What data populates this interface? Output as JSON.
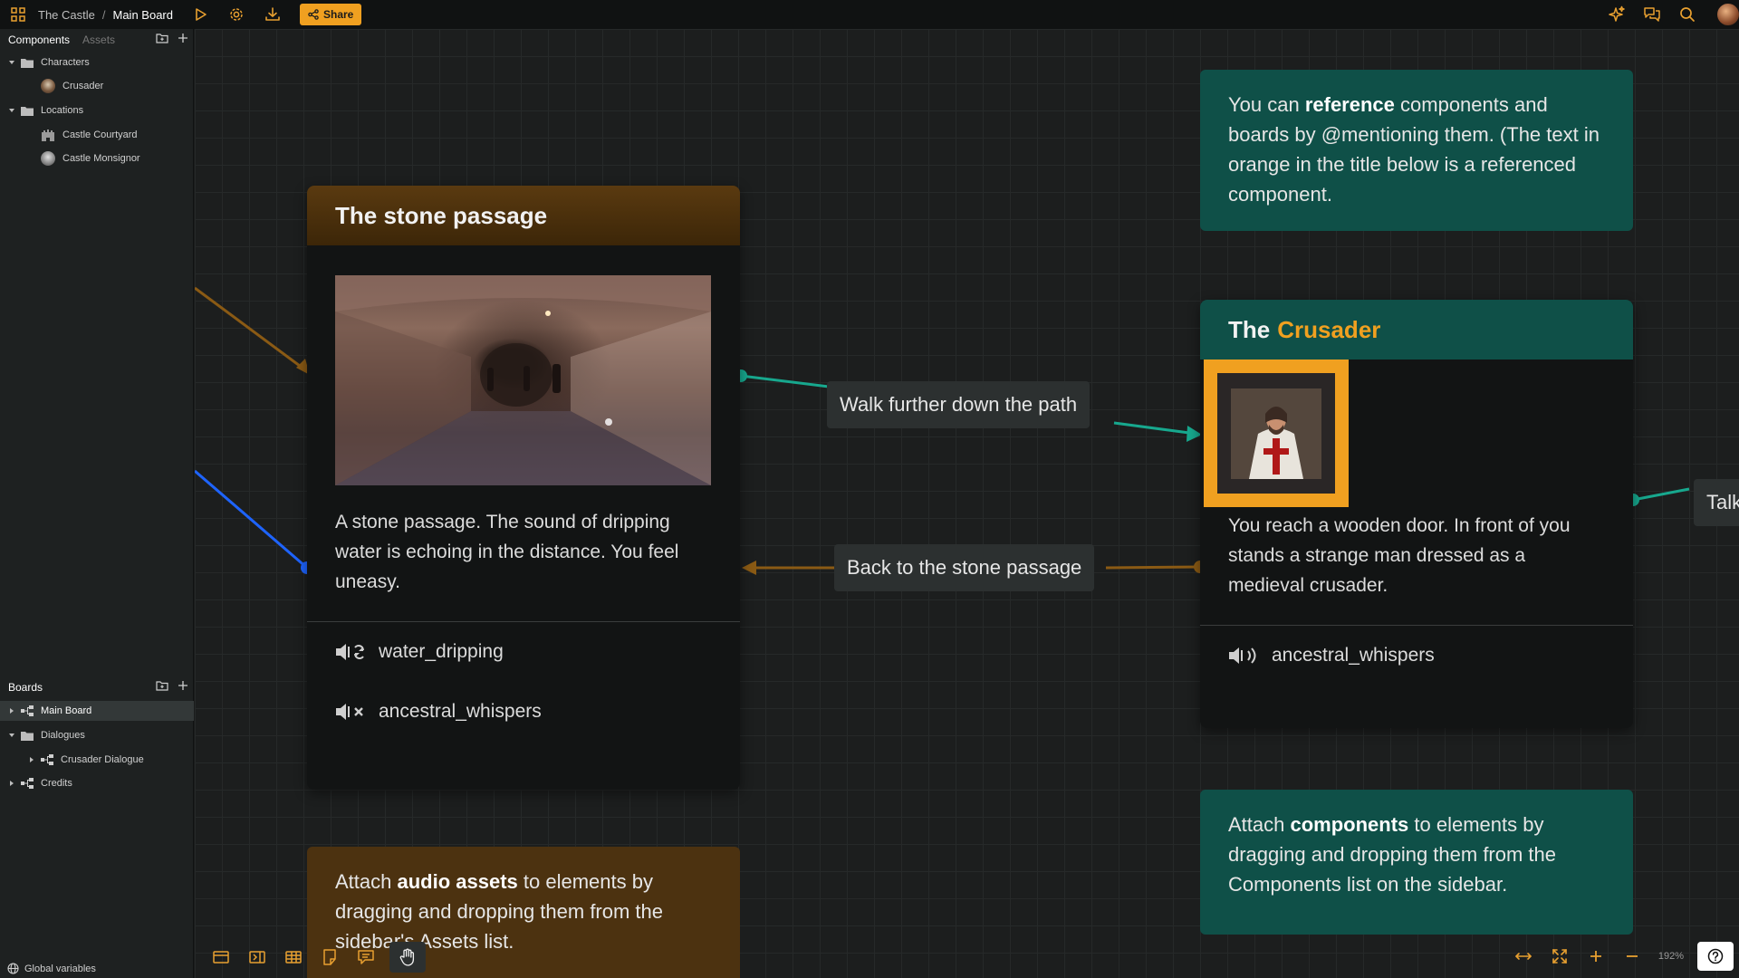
{
  "topbar": {
    "breadcrumb_project": "The Castle",
    "breadcrumb_sep": "/",
    "breadcrumb_board": "Main Board",
    "share_label": "Share"
  },
  "sidebar": {
    "components_tab": "Components",
    "assets_tab": "Assets",
    "components_tree": [
      {
        "label": "Characters",
        "type": "folder"
      },
      {
        "label": "Crusader",
        "type": "component"
      },
      {
        "label": "Locations",
        "type": "folder"
      },
      {
        "label": "Castle Courtyard",
        "type": "component"
      },
      {
        "label": "Castle Monsignor",
        "type": "component"
      }
    ],
    "boards_title": "Boards",
    "boards_tree": [
      {
        "label": "Main Board",
        "selected": true
      },
      {
        "label": "Dialogues",
        "type": "folder"
      },
      {
        "label": "Crusader Dialogue"
      },
      {
        "label": "Credits"
      }
    ],
    "global_variables": "Global variables"
  },
  "canvas": {
    "stone_passage": {
      "title": "The stone passage",
      "text": "A stone passage. The sound of dripping water is echoing in the distance. You feel uneasy.",
      "audio": [
        {
          "name": "water_dripping",
          "icon": "speaker-loop-icon"
        },
        {
          "name": "ancestral_whispers",
          "icon": "speaker-mute-icon"
        }
      ]
    },
    "crusader": {
      "title_prefix": "The",
      "title_ref": "Crusader",
      "text": "You reach a wooden door. In front of you stands a strange man dressed as a medieval crusader.",
      "audio": [
        {
          "name": "ancestral_whispers",
          "icon": "speaker-on-icon"
        }
      ]
    },
    "edges": {
      "forward": "Walk further down the path",
      "back": "Back to the stone passage",
      "talk": "Talk"
    },
    "notes": {
      "reference": {
        "pre": "You can ",
        "bold": "reference",
        "post": " components and boards by @mentioning them. (The text in orange in the title below is a referenced component."
      },
      "components": {
        "pre": "Attach ",
        "bold": "components",
        "post": " to elements by dragging and dropping them from the Components list on the sidebar."
      },
      "audio": {
        "pre": "Attach ",
        "bold": "audio assets",
        "post": " to elements by dragging and dropping them from the sidebar's Assets list."
      }
    }
  },
  "zoom": {
    "level": "192%"
  },
  "colors": {
    "accent": "#f0a020",
    "teal_header": "#0f5048",
    "brown_header": "#4a2e0e",
    "edge_teal": "#17a88e",
    "edge_brown": "#8a5a14",
    "edge_blue": "#1e64ff"
  }
}
